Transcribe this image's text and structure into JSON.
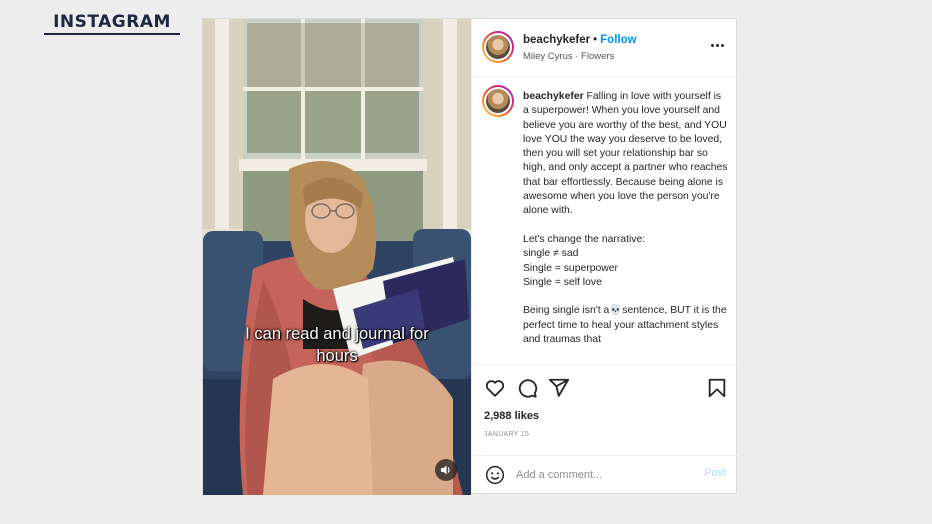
{
  "brand": {
    "label": "INSTAGRAM"
  },
  "post": {
    "username": "beachykefer",
    "follow_label": "Follow",
    "separator": "•",
    "audio": "Miley Cyrus · Flowers",
    "video_caption_line1": "I can read and journal for",
    "video_caption_line2": "hours",
    "caption": {
      "username": "beachykefer",
      "paragraph1": "Falling in love with yourself is a superpower! When you love yourself and believe you are worthy of the best, and YOU love YOU the way you deserve to be loved, then you will set your relationship bar so high, and only accept a partner who reaches that bar effortlessly. Because being alone is awesome when you love the person you're alone with.",
      "lines": [
        "Let's change the narrative:",
        "single ≠ sad",
        "Single = superpower",
        "Single = self love"
      ],
      "paragraph3": "Being single isn't a💀sentence, BUT it is the perfect time to heal your attachment styles and traumas that"
    },
    "likes": "2,988 likes",
    "date": "JANUARY 15",
    "comment_placeholder": "Add a comment...",
    "post_button": "Post"
  },
  "colors": {
    "brand": "#1b2840",
    "link_blue": "#0095f6",
    "post_disabled": "#b3dbff"
  },
  "icons": [
    "more-icon",
    "heart-icon",
    "comment-icon",
    "share-icon",
    "bookmark-icon",
    "emoji-icon",
    "volume-icon"
  ]
}
